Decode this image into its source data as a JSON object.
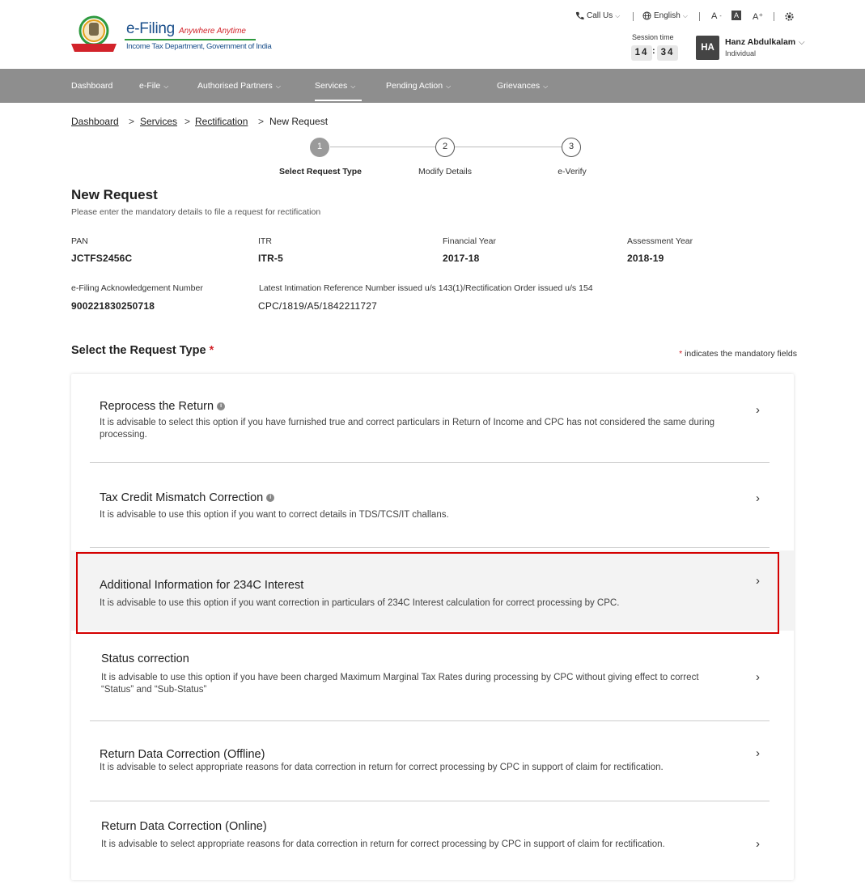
{
  "brand": {
    "title": "e-Filing",
    "tagline": "Anywhere Anytime",
    "subtitle": "Income Tax Department, Government of India"
  },
  "utility": {
    "call_us": "Call Us",
    "language": "English",
    "font_decrease": "A",
    "font_normal": "A",
    "font_increase": "A⁺"
  },
  "session": {
    "label": "Session time",
    "minutes": "14",
    "seconds": "34"
  },
  "user": {
    "initials": "HA",
    "name": "Hanz Abdulkalam",
    "type": "Individual"
  },
  "nav": {
    "items": [
      {
        "label": "Dashboard"
      },
      {
        "label": "e-File"
      },
      {
        "label": "Authorised Partners"
      },
      {
        "label": "Services"
      },
      {
        "label": "Pending Action"
      },
      {
        "label": "Grievances"
      }
    ]
  },
  "breadcrumb": {
    "items": [
      "Dashboard",
      "Services",
      "Rectification",
      "New Request"
    ],
    "separator": ">"
  },
  "stepper": {
    "steps": [
      {
        "number": "1",
        "label": "Select Request Type"
      },
      {
        "number": "2",
        "label": "Modify Details"
      },
      {
        "number": "3",
        "label": "e-Verify"
      }
    ]
  },
  "page": {
    "title": "New Request",
    "subtitle": "Please enter the mandatory details to file a request for rectification"
  },
  "details": {
    "pan_label": "PAN",
    "pan_value": "JCTFS2456C",
    "itr_label": "ITR",
    "itr_value": "ITR-5",
    "fy_label": "Financial Year",
    "fy_value": "2017-18",
    "ay_label": "Assessment Year",
    "ay_value": "2018-19",
    "ack_label": "e-Filing Acknowledgement Number",
    "ack_value": "900221830250718",
    "intimation_label": "Latest Intimation Reference Number issued u/s 143(1)/Rectification Order issued u/s 154",
    "intimation_value": "CPC/1819/A5/1842211727"
  },
  "request_type": {
    "title": "Select the Request Type",
    "required_marker": "*",
    "mandatory_note_star": "*",
    "mandatory_note": " indicates the mandatory fields"
  },
  "options": [
    {
      "title": "Reprocess the Return",
      "desc": "It is advisable to select this option if you have furnished true and correct particulars in Return of Income and CPC has not considered the same during processing."
    },
    {
      "title": "Tax Credit Mismatch Correction",
      "desc": "It is advisable to use this option if you want to correct details in TDS/TCS/IT challans."
    },
    {
      "title": "Additional Information for 234C Interest",
      "desc": "It is advisable to use this option if you want correction in particulars of 234C Interest calculation for correct processing by CPC."
    },
    {
      "title": "Status correction",
      "desc": "It is advisable to use this option if you have been charged Maximum Marginal Tax Rates during processing by CPC without giving effect to correct “Status” and “Sub-Status”"
    },
    {
      "title": "Return Data Correction (Offline)",
      "desc": "It is advisable to select appropriate reasons for data correction in return for correct processing by CPC in support of claim for rectification."
    },
    {
      "title": "Return Data Correction (Online)",
      "desc": "It is advisable to select appropriate reasons for data correction in return for correct processing by CPC in support of claim for rectification."
    }
  ],
  "icons": {
    "chevron": "›",
    "info": "i"
  },
  "colors": {
    "nav_bg": "#8e8e8e",
    "brand_blue": "#1a4f8b",
    "accent_red": "#d2232a",
    "highlight_bg": "#f3f3f3",
    "selection_border": "#d40000"
  }
}
